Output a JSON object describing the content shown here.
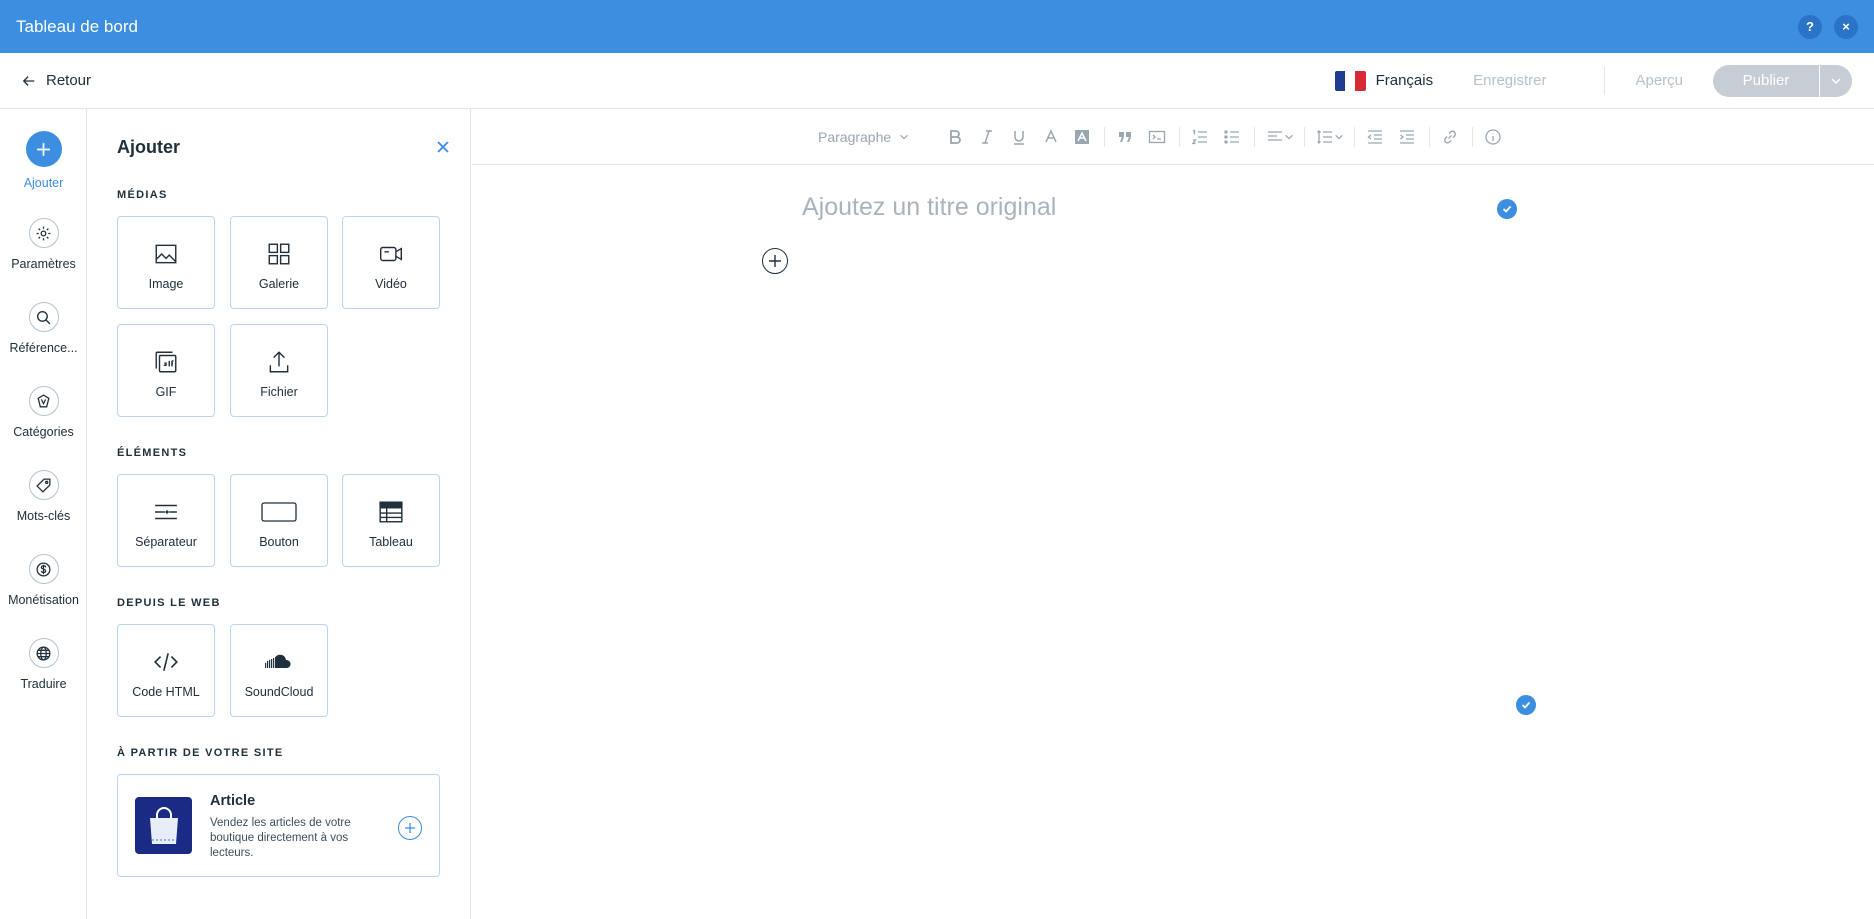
{
  "topbar": {
    "title": "Tableau de bord",
    "help_icon": "?",
    "close_icon": "×"
  },
  "actionbar": {
    "back_label": "Retour",
    "language": "Français",
    "flag_colors": [
      "#1f3c8f",
      "#ffffff",
      "#d62b37"
    ],
    "save_label": "Enregistrer",
    "preview_label": "Aperçu",
    "publish_label": "Publier"
  },
  "rail": {
    "items": [
      {
        "label": "Ajouter",
        "icon": "plus-icon",
        "active": true
      },
      {
        "label": "Paramètres",
        "icon": "gear-icon"
      },
      {
        "label": "Référence...",
        "icon": "search-icon"
      },
      {
        "label": "Catégories",
        "icon": "category-icon"
      },
      {
        "label": "Mots-clés",
        "icon": "tag-icon"
      },
      {
        "label": "Monétisation",
        "icon": "dollar-icon"
      },
      {
        "label": "Traduire",
        "icon": "globe-icon"
      }
    ]
  },
  "panel": {
    "title": "Ajouter",
    "sections": {
      "media": {
        "title": "MÉDIAS",
        "tiles": [
          {
            "label": "Image",
            "icon": "image-icon"
          },
          {
            "label": "Galerie",
            "icon": "gallery-icon"
          },
          {
            "label": "Vidéo",
            "icon": "video-icon"
          },
          {
            "label": "GIF",
            "icon": "gif-icon"
          },
          {
            "label": "Fichier",
            "icon": "upload-icon"
          }
        ]
      },
      "elements": {
        "title": "ÉLÉMENTS",
        "tiles": [
          {
            "label": "Séparateur",
            "icon": "divider-icon"
          },
          {
            "label": "Bouton",
            "icon": "button-icon"
          },
          {
            "label": "Tableau",
            "icon": "table-icon"
          }
        ]
      },
      "web": {
        "title": "DEPUIS LE WEB",
        "tiles": [
          {
            "label": "Code HTML",
            "icon": "code-icon"
          },
          {
            "label": "SoundCloud",
            "icon": "soundcloud-icon"
          }
        ]
      },
      "site": {
        "title": "À PARTIR DE VOTRE SITE",
        "article": {
          "title": "Article",
          "description": "Vendez les articles de votre boutique directement à vos lecteurs."
        }
      }
    }
  },
  "editor": {
    "toolbar": {
      "paragraph_label": "Paragraphe"
    },
    "title_placeholder": "Ajoutez un titre original"
  },
  "colors": {
    "accent": "#3b8ee0",
    "topbar": "#3b8ee0",
    "disabled": "#c7cdd4"
  }
}
